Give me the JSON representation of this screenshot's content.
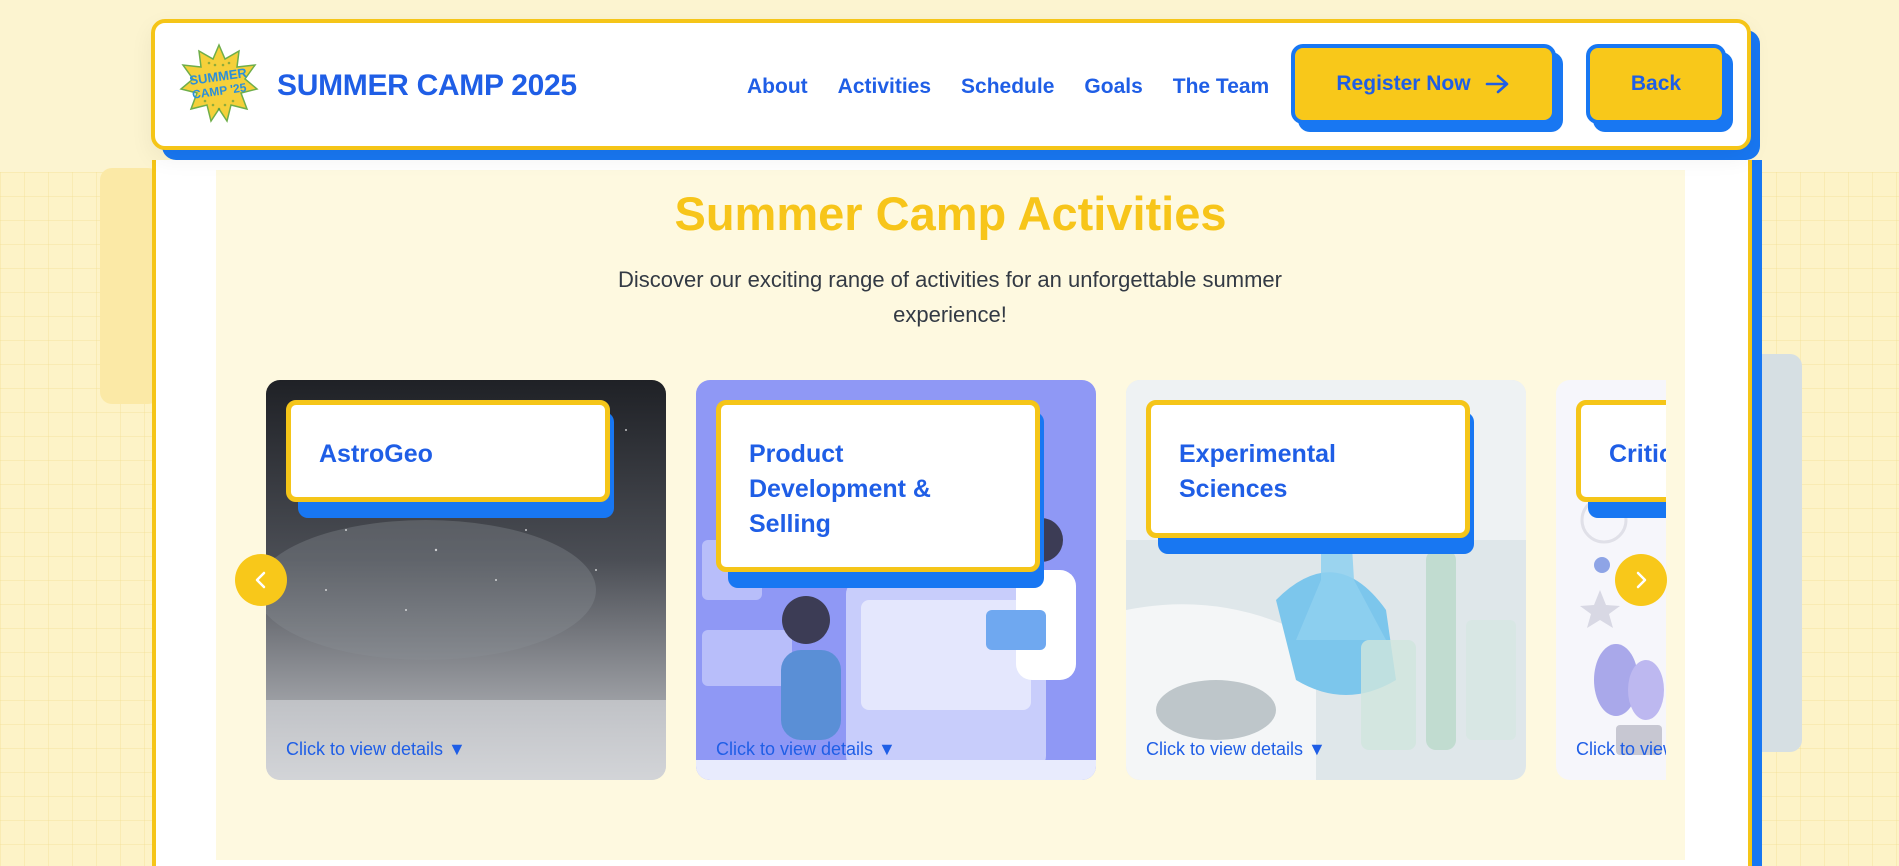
{
  "header": {
    "logo_text": "SUMMER CAMP '25",
    "brand": "SUMMER CAMP 2025",
    "nav": [
      "About",
      "Activities",
      "Schedule",
      "Goals",
      "The Team"
    ],
    "register_label": "Register Now",
    "back_label": "Back"
  },
  "section": {
    "title": "Summer Camp Activities",
    "subtitle": "Discover our exciting range of activities for an unforgettable summer experience!"
  },
  "carousel": {
    "cta": "Click to view details ▼",
    "cards": [
      {
        "title": "AstroGeo",
        "icon": "night-sky-image"
      },
      {
        "title": "Product Development & Selling",
        "icon": "team-illustration-image"
      },
      {
        "title": "Experimental Sciences",
        "icon": "lab-experiment-image"
      },
      {
        "title": "Critic",
        "icon": "plant-illustration-image"
      }
    ],
    "prev_icon": "chevron-left-icon",
    "next_icon": "chevron-right-icon"
  },
  "colors": {
    "brand_blue": "#1f5ee6",
    "accent_yellow": "#f7c51a",
    "shadow_blue": "#1877f2"
  }
}
